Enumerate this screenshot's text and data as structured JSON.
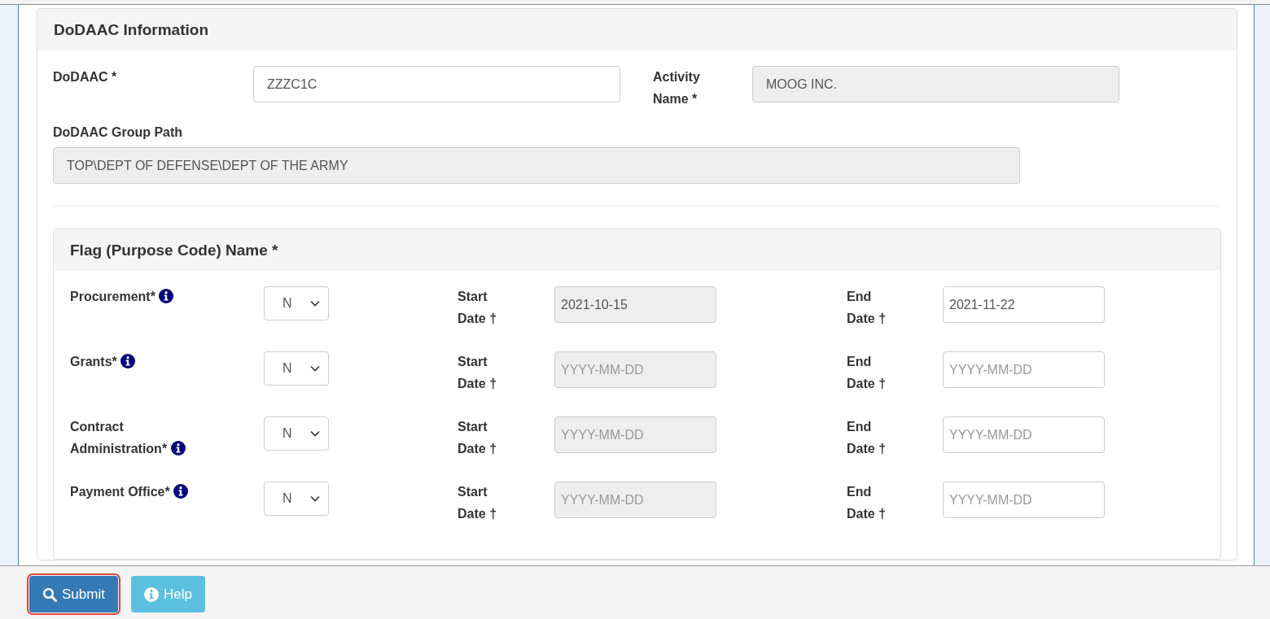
{
  "dodaac_panel": {
    "title": "DoDAAC Information",
    "fields": [
      {
        "label": "DoDAAC *",
        "value": "ZZZC1C",
        "disabled": false
      },
      {
        "label": "Activity Name *",
        "value": "MOOG INC.",
        "disabled": true
      }
    ],
    "group_path": {
      "label": "DoDAAC Group Path",
      "value": "TOP\\DEPT OF DEFENSE\\DEPT OF THE ARMY",
      "disabled": true
    }
  },
  "flag_panel": {
    "title": "Flag (Purpose Code) Name *",
    "rows": [
      {
        "label": "Procurement*",
        "select_value": "N",
        "start_label": "Start Date †",
        "start": {
          "value": "2021-10-15",
          "disabled": true
        },
        "end_label": "End Date †",
        "end": {
          "value": "2021-11-22",
          "disabled": false
        }
      },
      {
        "label": "Grants*",
        "select_value": "N",
        "start_label": "Start Date †",
        "start": {
          "placeholder": "YYYY-MM-DD",
          "disabled": true
        },
        "end_label": "End Date †",
        "end": {
          "placeholder": "YYYY-MM-DD",
          "disabled": false
        }
      },
      {
        "label": "Contract Administration*",
        "select_value": "N",
        "start_label": "Start Date †",
        "start": {
          "placeholder": "YYYY-MM-DD",
          "disabled": true
        },
        "end_label": "End Date †",
        "end": {
          "placeholder": "YYYY-MM-DD",
          "disabled": false
        }
      },
      {
        "label": "Payment Office*",
        "select_value": "N",
        "start_label": "Start Date †",
        "start": {
          "placeholder": "YYYY-MM-DD",
          "disabled": true
        },
        "end_label": "End Date †",
        "end": {
          "placeholder": "YYYY-MM-DD",
          "disabled": false
        }
      }
    ]
  },
  "footer": {
    "buttons": [
      {
        "label": "Submit",
        "kind": "primary",
        "focused": true
      },
      {
        "label": "Help",
        "kind": "info",
        "focused": false
      }
    ]
  }
}
